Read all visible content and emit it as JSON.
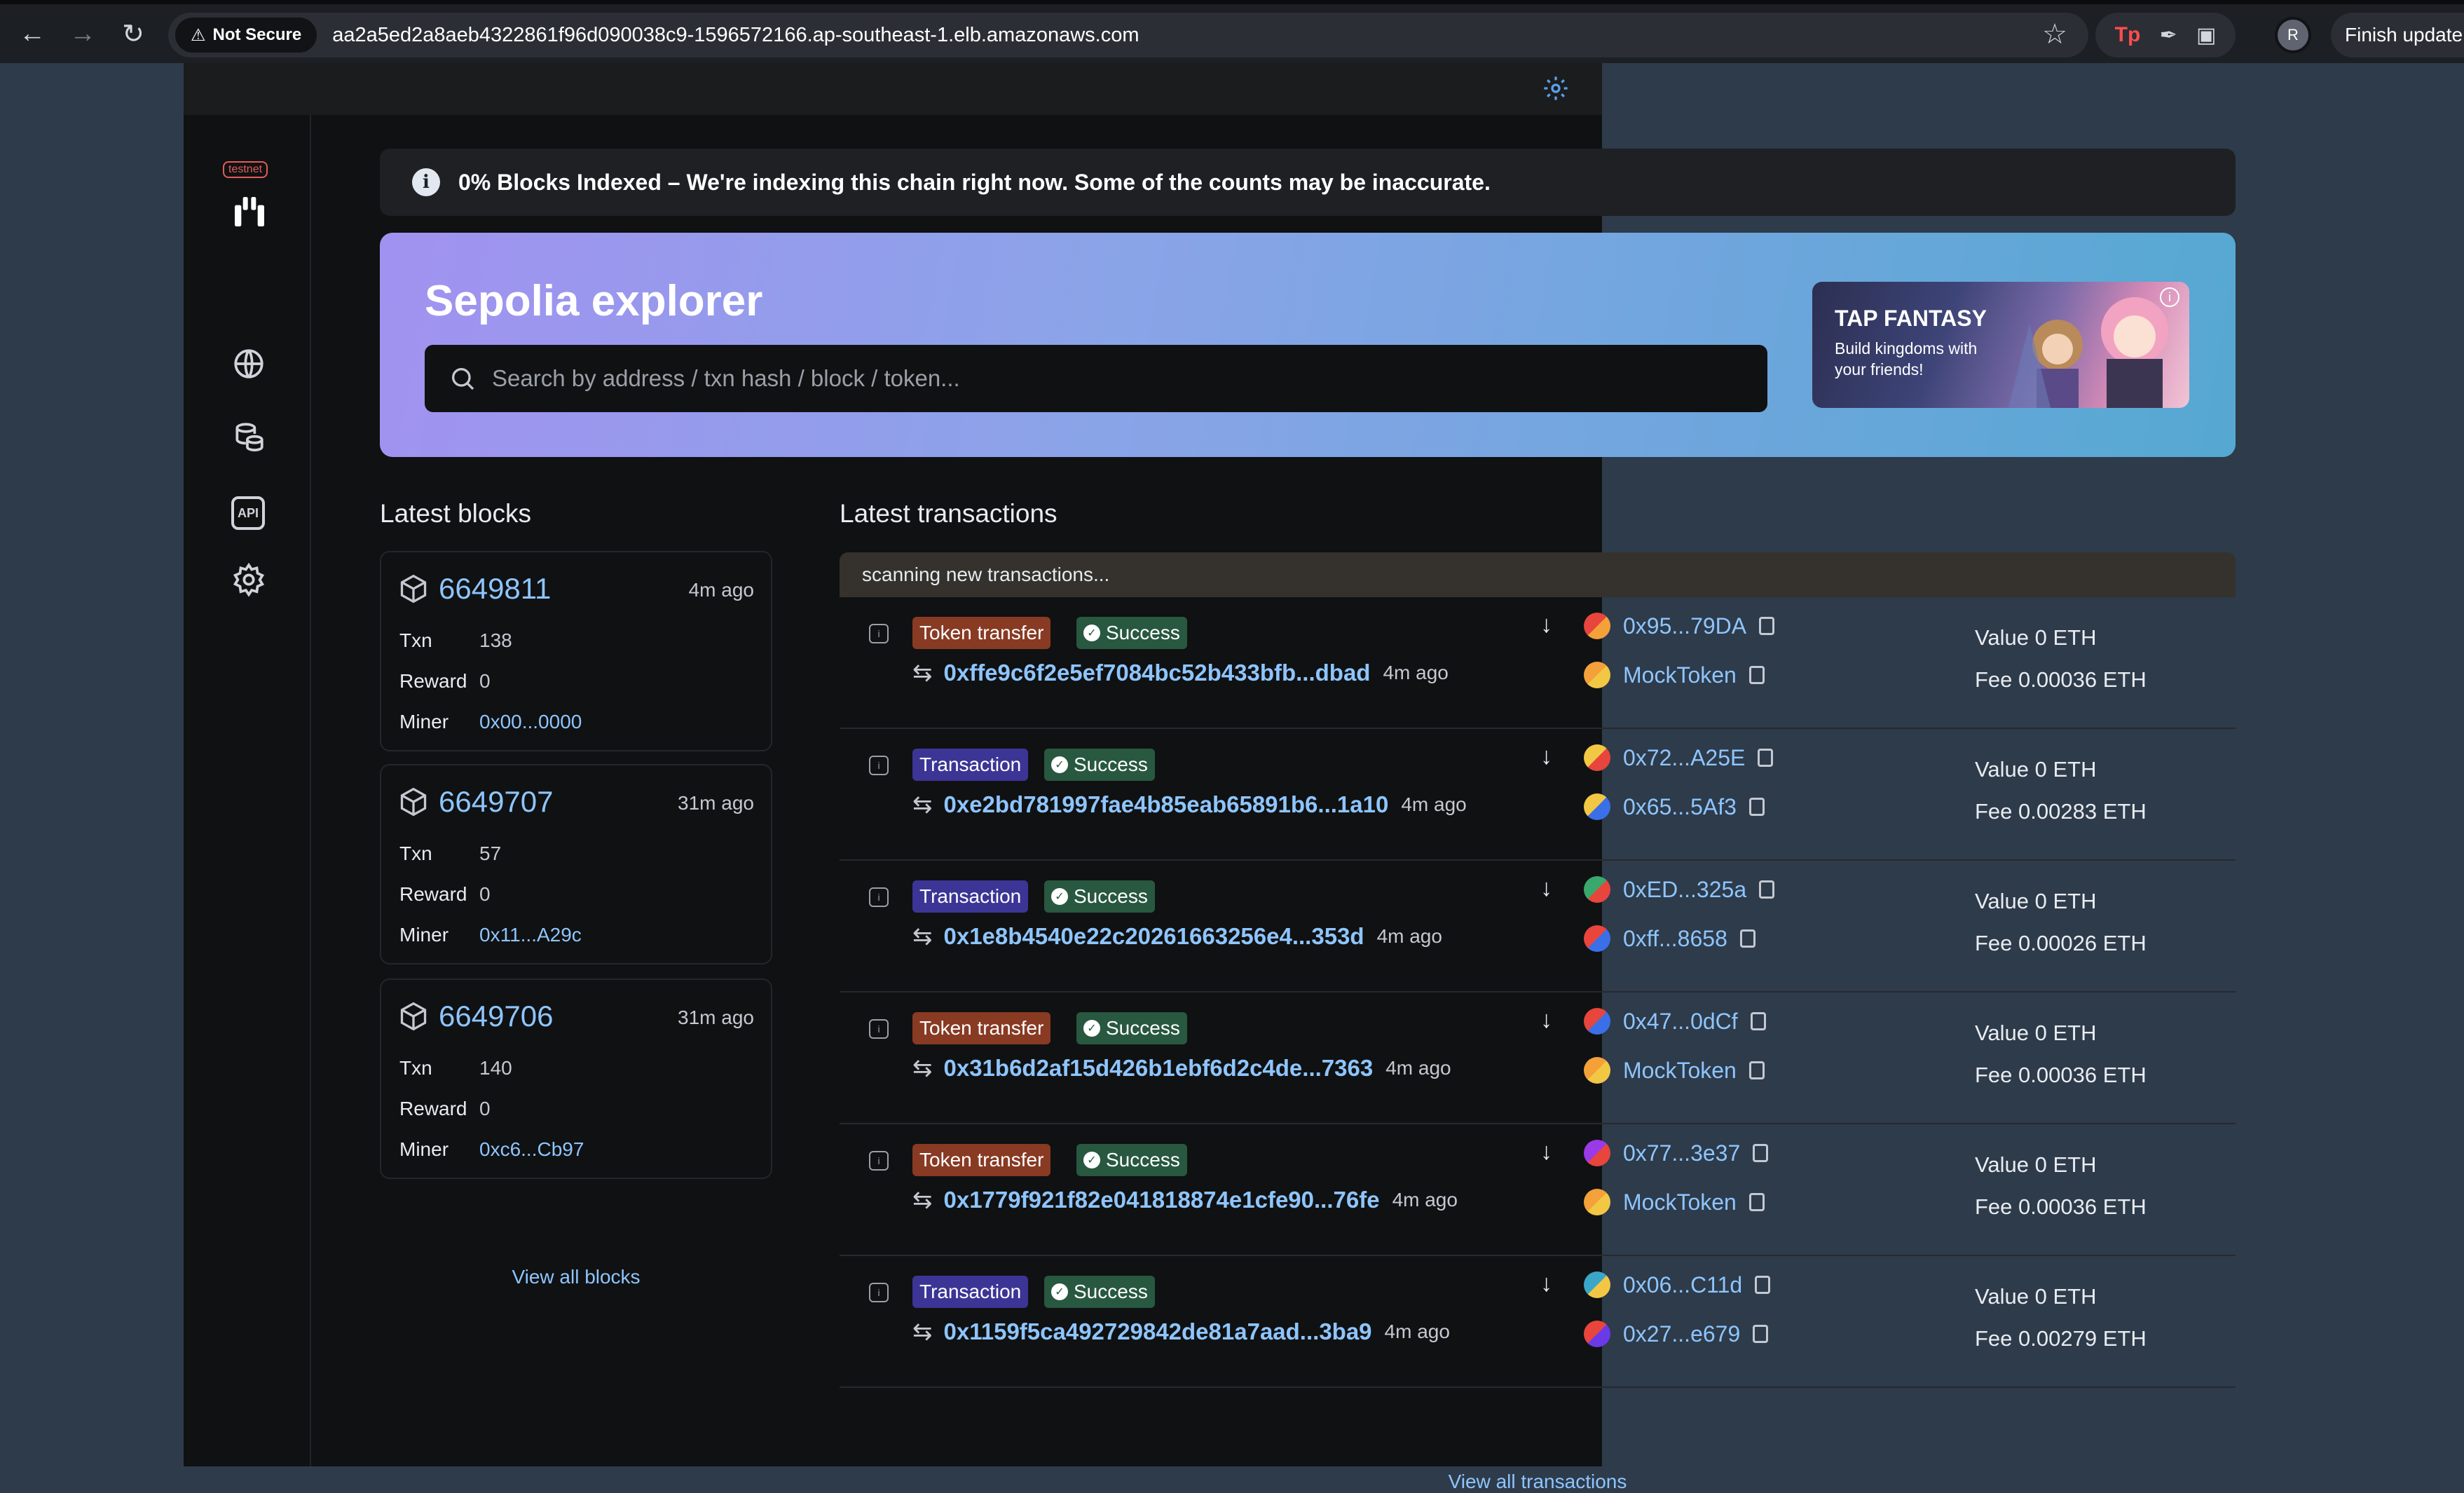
{
  "browser": {
    "security_label": "Not Secure",
    "url": "aa2a5ed2a8aeb4322861f96d090038c9-1596572166.ap-southeast-1.elb.amazonaws.com",
    "ext_tp": "Tp",
    "profile_initial": "R",
    "finish_update": "Finish update"
  },
  "sidebar": {
    "network_badge": "testnet",
    "api_label": "API"
  },
  "index_banner": {
    "icon": "i",
    "text": "0% Blocks Indexed – We're indexing this chain right now. Some of the counts may be inaccurate."
  },
  "hero": {
    "title": "Sepolia explorer",
    "search_placeholder": "Search by address / txn hash / block / token...",
    "ad_title": "TAP FANTASY",
    "ad_subtitle": "Build kingdoms with your friends!",
    "ad_info": "i"
  },
  "blocks": {
    "title": "Latest blocks",
    "txn_label": "Txn",
    "reward_label": "Reward",
    "miner_label": "Miner",
    "items": [
      {
        "number": "6649811",
        "age": "4m ago",
        "txn": "138",
        "reward": "0",
        "miner": "0x00...0000"
      },
      {
        "number": "6649707",
        "age": "31m ago",
        "txn": "57",
        "reward": "0",
        "miner": "0x11...A29c"
      },
      {
        "number": "6649706",
        "age": "31m ago",
        "txn": "140",
        "reward": "0",
        "miner": "0xc6...Cb97"
      }
    ],
    "view_all": "View all blocks"
  },
  "transactions": {
    "title": "Latest transactions",
    "scanning": "scanning new transactions...",
    "items": [
      {
        "type": "Token transfer",
        "status": "Success",
        "hash": "0xffe9c6f2e5ef7084bc52b433bfb...dbad",
        "age": "4m ago",
        "from": "0x95...79DA",
        "to": "MockToken",
        "value": "Value 0 ETH",
        "fee": "Fee 0.00036 ETH"
      },
      {
        "type": "Transaction",
        "status": "Success",
        "hash": "0xe2bd781997fae4b85eab65891b6...1a10",
        "age": "4m ago",
        "from": "0x72...A25E",
        "to": "0x65...5Af3",
        "value": "Value 0 ETH",
        "fee": "Fee 0.00283 ETH"
      },
      {
        "type": "Transaction",
        "status": "Success",
        "hash": "0x1e8b4540e22c20261663256e4...353d",
        "age": "4m ago",
        "from": "0xED...325a",
        "to": "0xff...8658",
        "value": "Value 0 ETH",
        "fee": "Fee 0.00026 ETH"
      },
      {
        "type": "Token transfer",
        "status": "Success",
        "hash": "0x31b6d2af15d426b1ebf6d2c4de...7363",
        "age": "4m ago",
        "from": "0x47...0dCf",
        "to": "MockToken",
        "value": "Value 0 ETH",
        "fee": "Fee 0.00036 ETH"
      },
      {
        "type": "Token transfer",
        "status": "Success",
        "hash": "0x1779f921f82e041818874e1cfe90...76fe",
        "age": "4m ago",
        "from": "0x77...3e37",
        "to": "MockToken",
        "value": "Value 0 ETH",
        "fee": "Fee 0.00036 ETH"
      },
      {
        "type": "Transaction",
        "status": "Success",
        "hash": "0x1159f5ca492729842de81a7aad...3ba9",
        "age": "4m ago",
        "from": "0x06...C11d",
        "to": "0x27...e679",
        "value": "Value 0 ETH",
        "fee": "Fee 0.00279 ETH"
      }
    ],
    "view_all": "View all transactions"
  },
  "colors": {
    "accent_link": "#8ec5ff",
    "token_transfer_badge": "#883a23",
    "transaction_badge": "#3c3596",
    "success_badge": "#285840"
  }
}
